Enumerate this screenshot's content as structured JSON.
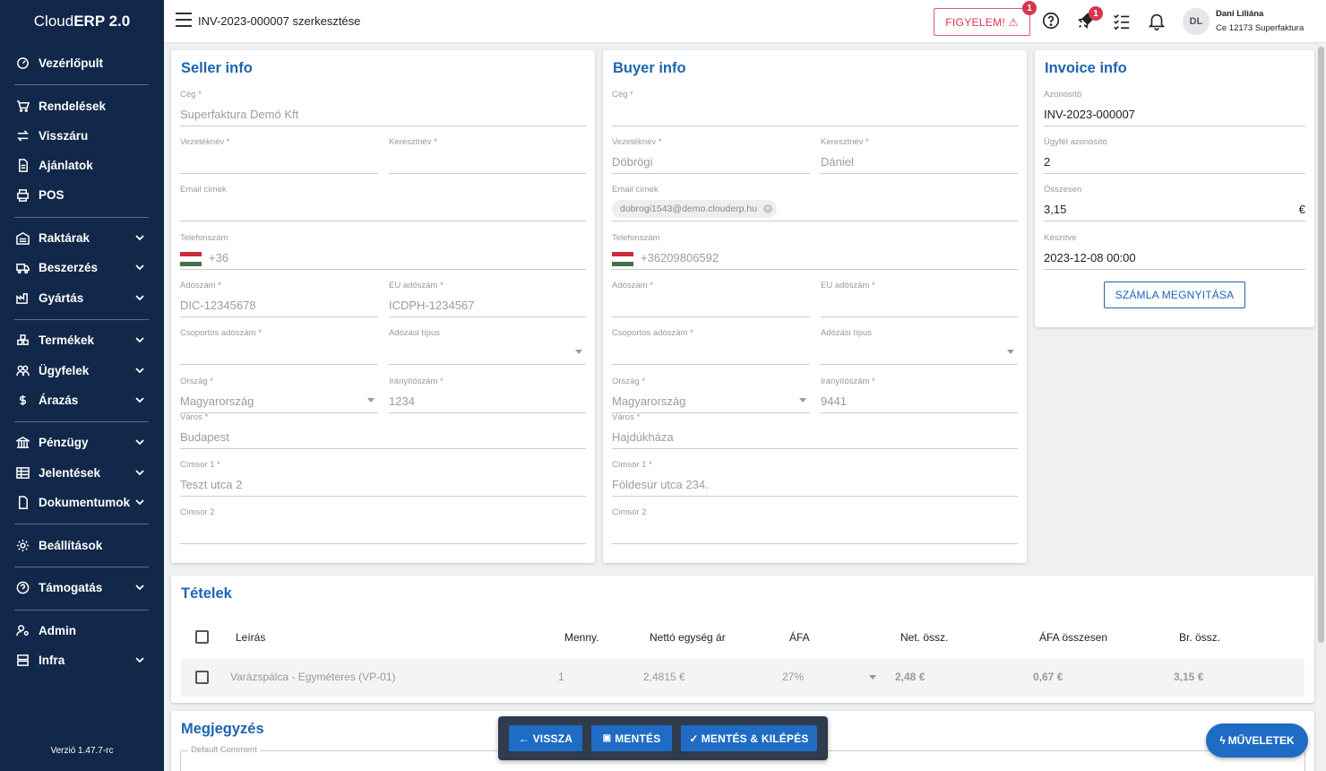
{
  "app": {
    "logo_prefix": "Cloud",
    "logo_main": "ERP 2.0",
    "version": "Verzió 1.47.7-rc"
  },
  "sidebar": {
    "items": [
      {
        "label": "Vezérlőpult",
        "icon": "dashboard-icon"
      },
      {
        "label": "Rendelések",
        "icon": "cart-icon"
      },
      {
        "label": "Visszáru",
        "icon": "swap-icon"
      },
      {
        "label": "Ajánlatok",
        "icon": "document-icon"
      },
      {
        "label": "POS",
        "icon": "printer-icon"
      },
      {
        "label": "Raktárak",
        "icon": "warehouse-icon",
        "expandable": true
      },
      {
        "label": "Beszerzés",
        "icon": "truck-icon",
        "expandable": true
      },
      {
        "label": "Gyártás",
        "icon": "factory-icon",
        "expandable": true
      },
      {
        "label": "Termékek",
        "icon": "boxes-icon",
        "expandable": true
      },
      {
        "label": "Ügyfelek",
        "icon": "users-icon",
        "expandable": true
      },
      {
        "label": "Árazás",
        "icon": "dollar-icon",
        "expandable": true
      },
      {
        "label": "Pénzügy",
        "icon": "bank-icon",
        "expandable": true
      },
      {
        "label": "Jelentések",
        "icon": "table-icon",
        "expandable": true
      },
      {
        "label": "Dokumentumok",
        "icon": "file-icon",
        "expandable": true
      },
      {
        "label": "Beállítások",
        "icon": "gear-icon"
      },
      {
        "label": "Támogatás",
        "icon": "help-icon",
        "expandable": true
      },
      {
        "label": "Admin",
        "icon": "admin-icon"
      },
      {
        "label": "Infra",
        "icon": "server-icon",
        "expandable": true
      }
    ]
  },
  "topbar": {
    "title": "INV-2023-000007 szerkesztése",
    "warning_label": "FIGYELEM! ⚠",
    "warning_badge": "1",
    "rocket_badge": "1",
    "user_initials": "DL",
    "user_name": "Dani Liliána",
    "user_company": "Ce 12173 Superfaktura"
  },
  "seller": {
    "title": "Seller info",
    "company_label": "Cég *",
    "company": "Superfaktura Demó Kft",
    "lastname_label": "Vezetéknév *",
    "lastname": "",
    "firstname_label": "Keresztnév *",
    "firstname": "",
    "email_label": "Email címek",
    "phone_label": "Telefonszám",
    "phone": "+36",
    "tax_label": "Adószám *",
    "tax": "DIC-12345678",
    "eutax_label": "EU adószám *",
    "eutax": "ICDPH-1234567",
    "grouptax_label": "Csoportos adószám *",
    "taxtype_label": "Adózási típus",
    "country_label": "Ország *",
    "country": "Magyarország",
    "zip_label": "Irányítószám *",
    "zip": "1234",
    "city_label": "Város *",
    "city": "Budapest",
    "addr1_label": "Címsor 1 *",
    "addr1": "Teszt utca 2",
    "addr2_label": "Címsor 2"
  },
  "buyer": {
    "title": "Buyer info",
    "company_label": "Cég *",
    "company": "",
    "lastname_label": "Vezetéknév *",
    "lastname": "Döbrögi",
    "firstname_label": "Keresztnév *",
    "firstname": "Dániel",
    "email_label": "Email címek",
    "email_chip": "dobrogi1543@demo.clouderp.hu",
    "phone_label": "Telefonszám",
    "phone": "+36209806592",
    "tax_label": "Adószám *",
    "eutax_label": "EU adószám *",
    "grouptax_label": "Csoportos adószám *",
    "taxtype_label": "Adózási típus",
    "country_label": "Ország *",
    "country": "Magyarország",
    "zip_label": "Irányítószám *",
    "zip": "9441",
    "city_label": "Város *",
    "city": "Hajdúkháza",
    "addr1_label": "Címsor 1 *",
    "addr1": "Földesúr utca 234.",
    "addr2_label": "Címsor 2"
  },
  "invoice": {
    "title": "Invoice info",
    "id_label": "Azonosító",
    "id": "INV-2023-000007",
    "customer_label": "Ügyfél azonosító",
    "customer": "2",
    "total_label": "Összesen",
    "total": "3,15",
    "currency": "€",
    "created_label": "Készítve",
    "created": "2023-12-08 00:00",
    "open_button": "SZÁMLA MEGNYITÁSA"
  },
  "items": {
    "title": "Tételek",
    "headers": [
      "Leírás",
      "Menny.",
      "Nettó egység ár",
      "ÁFA",
      "Net. össz.",
      "ÁFA összesen",
      "Br. össz."
    ],
    "rows": [
      {
        "desc": "Varázspálca - Egyméteres (VP-01)",
        "qty": "1",
        "unit": "2,4815 €",
        "vat": "27%",
        "net": "2,48 €",
        "vat_total": "0,67 €",
        "gross": "3,15 €"
      }
    ]
  },
  "notes": {
    "title": "Megjegyzés",
    "comment_label": "Default Comment"
  },
  "actions": {
    "back": "← VISSZA",
    "save": "MENTÉS",
    "save_exit": "MENTÉS & KILÉPÉS",
    "operations": "MŰVELETEK"
  }
}
